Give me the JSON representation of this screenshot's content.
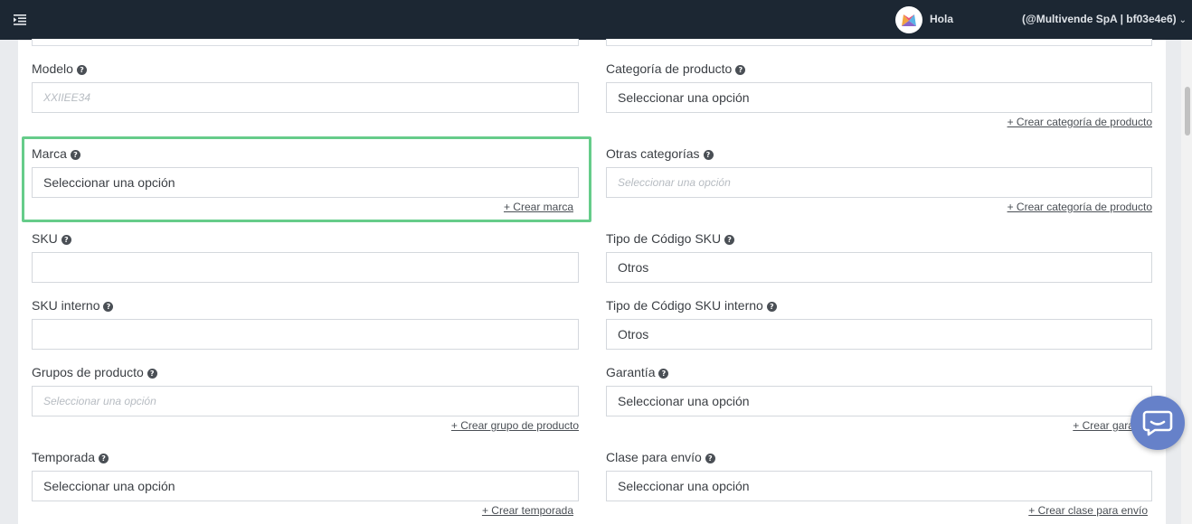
{
  "header": {
    "greeting": "Hola",
    "account": "(@Multivende SpA | bf03e4e6)"
  },
  "icons": {
    "menu": "menu-indent-icon",
    "logo": "multivende-logo-icon",
    "help": "question-circle-icon",
    "chevron": "chevron-down-icon",
    "chat": "chat-bubble-icon"
  },
  "colors": {
    "topbar": "#1c2733",
    "highlight": "#66cc8a",
    "chat": "#6681c9"
  },
  "help_glyph": "?",
  "chevron_glyph": "⌄",
  "form": {
    "modelo": {
      "label": "Modelo",
      "placeholder": "XXIIEE34"
    },
    "categoria": {
      "label": "Categoría de producto",
      "value": "Seleccionar una opción",
      "link": "+ Crear categoría de producto"
    },
    "marca": {
      "label": "Marca",
      "value": "Seleccionar una opción",
      "link": "+ Crear marca"
    },
    "otras_categorias": {
      "label": "Otras categorías",
      "placeholder": "Seleccionar una opción",
      "link": "+ Crear categoría de producto"
    },
    "sku": {
      "label": "SKU",
      "value": ""
    },
    "tipo_sku": {
      "label": "Tipo de Código SKU",
      "value": "Otros"
    },
    "sku_interno": {
      "label": "SKU interno",
      "value": ""
    },
    "tipo_sku_interno": {
      "label": "Tipo de Código SKU interno",
      "value": "Otros"
    },
    "grupos": {
      "label": "Grupos de producto",
      "placeholder": "Seleccionar una opción",
      "link": "+ Crear grupo de producto"
    },
    "garantia": {
      "label": "Garantía",
      "value": "Seleccionar una opción",
      "link": "+ Crear garantía"
    },
    "temporada": {
      "label": "Temporada",
      "value": "Seleccionar una opción",
      "link": "+ Crear temporada"
    },
    "clase_envio": {
      "label": "Clase para envío",
      "value": "Seleccionar una opción",
      "link": "+ Crear clase para envío"
    }
  }
}
